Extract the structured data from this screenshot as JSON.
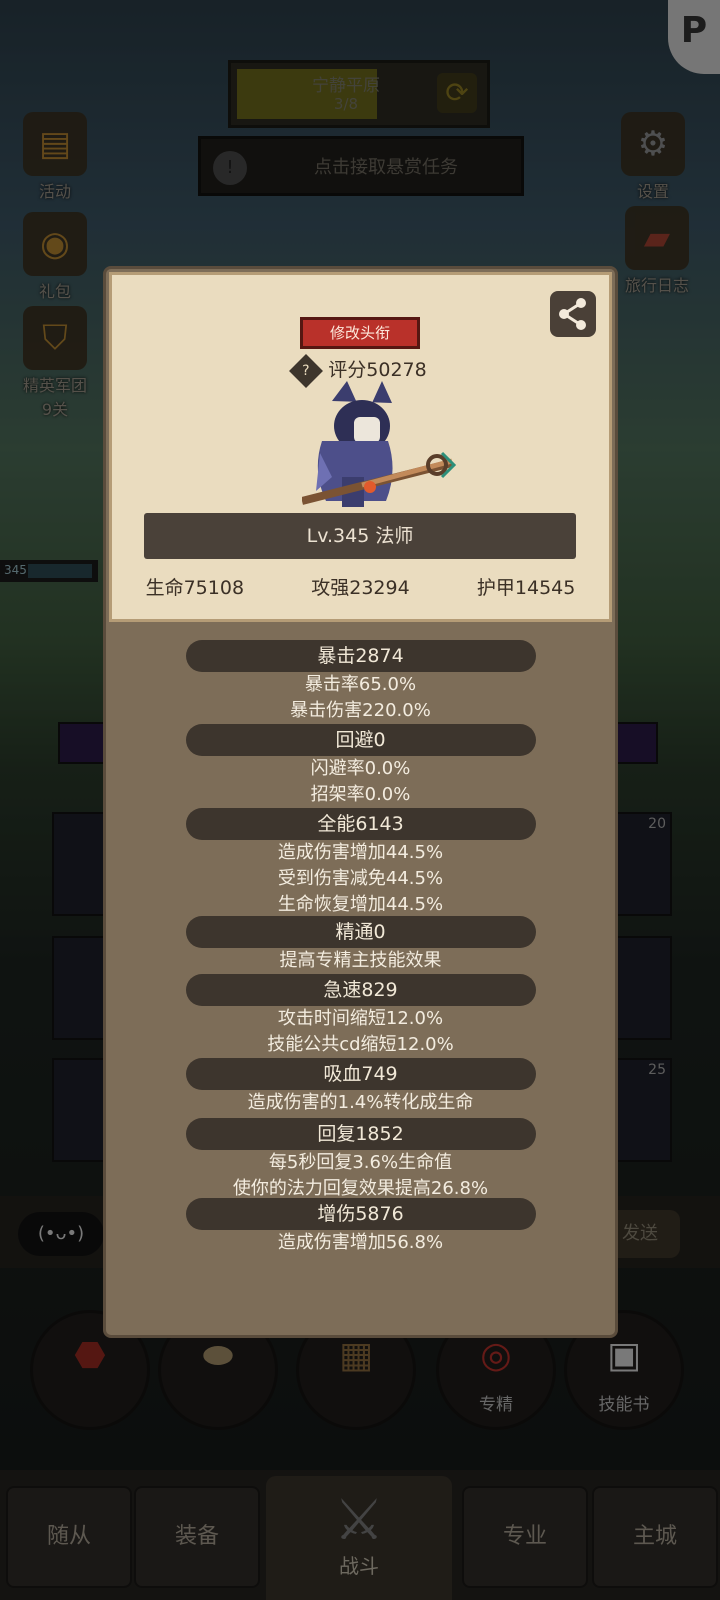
{
  "background": {
    "zone": {
      "name": "宁静平原",
      "progress": "3/8",
      "refresh_icon": "refresh-icon"
    },
    "bounty": {
      "label": "点击接取悬赏任务"
    },
    "left_icons": [
      {
        "label": "活动",
        "icon": "scroll-icon"
      },
      {
        "label": "礼包",
        "icon": "coin-icon"
      },
      {
        "label": "精英军团\n9关",
        "icon": "helmet-icon"
      }
    ],
    "right_icons": [
      {
        "label": "设置",
        "icon": "gear-icon"
      },
      {
        "label": "旅行日志",
        "icon": "book-icon"
      }
    ],
    "hero_level_chip": {
      "level": "345"
    },
    "slots": [
      {
        "count": "20"
      },
      {
        "count": "25"
      }
    ],
    "chat": {
      "left": "(•ᴗ•)",
      "right": "发送"
    },
    "skill_buttons": [
      {
        "label": "",
        "icon": "potion-icon"
      },
      {
        "label": "",
        "icon": "bread-icon"
      },
      {
        "label": "",
        "icon": "chest-icon"
      },
      {
        "label": "专精",
        "icon": "target-icon"
      },
      {
        "label": "技能书",
        "icon": "book-icon"
      }
    ],
    "nav": [
      {
        "label": "随从"
      },
      {
        "label": "装备"
      },
      {
        "label": "战斗"
      },
      {
        "label": "专业"
      },
      {
        "label": "主城"
      }
    ]
  },
  "profile": {
    "rename_label": "修改头衔",
    "score": "评分50278",
    "level_class": "Lv.345 法师",
    "base_stats": [
      "生命75108",
      "攻强23294",
      "护甲14545"
    ]
  },
  "stats": [
    {
      "title": "暴击2874",
      "lines": [
        "暴击率65.0%",
        "暴击伤害220.0%"
      ]
    },
    {
      "title": "回避0",
      "lines": [
        "闪避率0.0%",
        "招架率0.0%"
      ]
    },
    {
      "title": "全能6143",
      "lines": [
        "造成伤害增加44.5%",
        "受到伤害减免44.5%",
        "生命恢复增加44.5%"
      ]
    },
    {
      "title": "精通0",
      "lines": [
        "提高专精主技能效果"
      ]
    },
    {
      "title": "急速829",
      "lines": [
        "攻击时间缩短12.0%",
        "技能公共cd缩短12.0%"
      ]
    },
    {
      "title": "吸血749",
      "lines": [
        "造成伤害的1.4%转化成生命"
      ]
    },
    {
      "title": "回复1852",
      "lines": [
        "每5秒回复3.6%生命值",
        "使你的法力回复效果提高26.8%"
      ]
    },
    {
      "title": "增伤5876",
      "lines": [
        "造成伤害增加56.8%"
      ]
    }
  ]
}
